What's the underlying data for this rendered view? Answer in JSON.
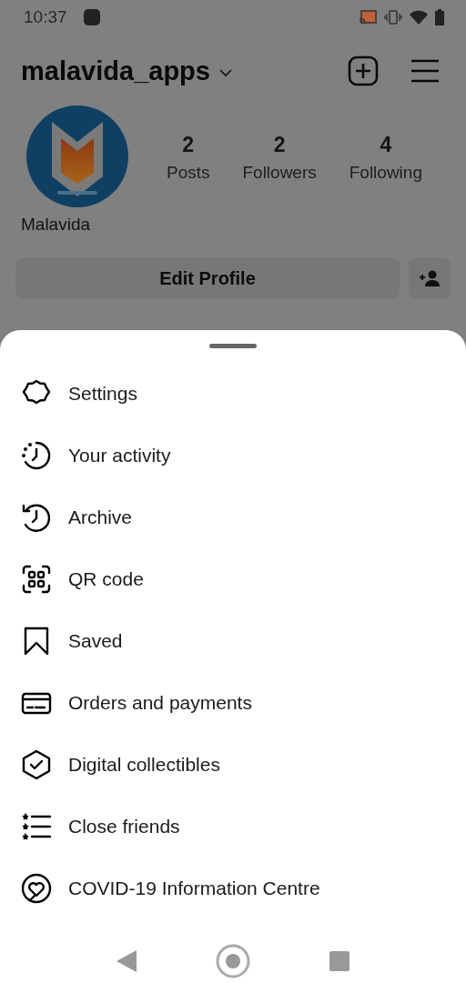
{
  "status_bar": {
    "time": "10:37"
  },
  "header": {
    "username": "malavida_apps"
  },
  "profile": {
    "name": "Malavida",
    "stats": [
      {
        "value": "2",
        "label": "Posts"
      },
      {
        "value": "2",
        "label": "Followers"
      },
      {
        "value": "4",
        "label": "Following"
      }
    ],
    "edit_button": "Edit Profile"
  },
  "menu": [
    {
      "kind": "settings",
      "label": "Settings"
    },
    {
      "kind": "activity",
      "label": "Your activity"
    },
    {
      "kind": "archive",
      "label": "Archive"
    },
    {
      "kind": "qr",
      "label": "QR code"
    },
    {
      "kind": "saved",
      "label": "Saved"
    },
    {
      "kind": "card",
      "label": "Orders and payments"
    },
    {
      "kind": "collectibles",
      "label": "Digital collectibles"
    },
    {
      "kind": "friends",
      "label": "Close friends"
    },
    {
      "kind": "covid",
      "label": "COVID-19 Information Centre"
    }
  ]
}
